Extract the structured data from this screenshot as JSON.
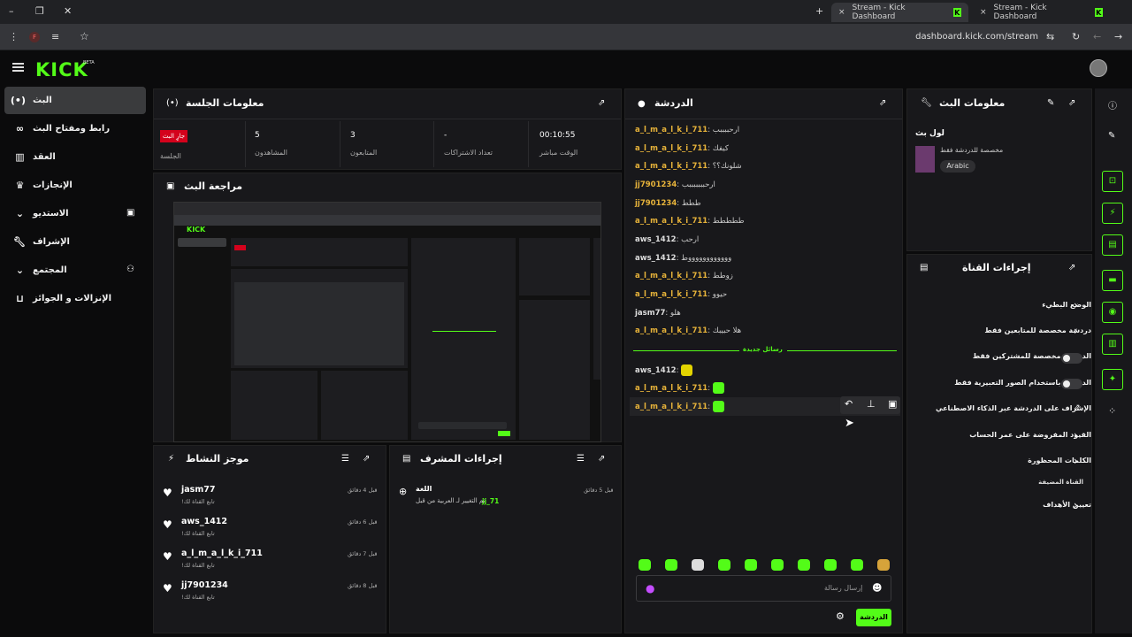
{
  "browser": {
    "tabs": [
      {
        "title": "Stream - Kick Dashboard"
      },
      {
        "title": "Stream - Kick Dashboard"
      }
    ],
    "url": "dashboard.kick.com/stream",
    "plus": "+",
    "close": "×"
  },
  "header": {
    "logo": "KICK",
    "beta": "BETA"
  },
  "sidebar": {
    "items": [
      {
        "label": "البث"
      },
      {
        "label": "رابط ومفتاح البث"
      },
      {
        "label": "العقد"
      },
      {
        "label": "الإنجازات"
      },
      {
        "label": "الاستديو"
      },
      {
        "label": "الإشراف"
      },
      {
        "label": "المجتمع"
      },
      {
        "label": "الإنزالات و الجوائز"
      }
    ]
  },
  "session": {
    "title": "معلومات الجلسة",
    "live_badge": "جارٍ البث",
    "stats": [
      {
        "value": "",
        "label": "الجلسة"
      },
      {
        "value": "5",
        "label": "المشاهدون"
      },
      {
        "value": "3",
        "label": "المتابعون"
      },
      {
        "value": "-",
        "label": "تعداد الاشتراكات"
      },
      {
        "value": "00:10:55",
        "label": "الوقت مباشر"
      }
    ]
  },
  "preview": {
    "title": "مراجعة البث"
  },
  "activity": {
    "title": "موجز النشاط",
    "items": [
      {
        "name": "jasm77",
        "sub": "تابع القناة لك!",
        "time": "قبل 4 دقائق"
      },
      {
        "name": "aws_1412",
        "sub": "تابع القناة لك!",
        "time": "قبل 6 دقائق"
      },
      {
        "name": "a_l_m_a_l_k_i_711",
        "sub": "تابع القناة لك!",
        "time": "قبل 7 دقائق"
      },
      {
        "name": "jj7901234",
        "sub": "تابع القناة لك!",
        "time": "قبل 8 دقائق"
      }
    ]
  },
  "modactions": {
    "title": "إجراءات المشرف",
    "items": [
      {
        "title": "اللغة",
        "user": "jj_71",
        "text": "تم التغيير لـ العربية من قبل",
        "time": "قبل 5 دقائق"
      }
    ]
  },
  "chat": {
    "title": "الدردشة",
    "messages": [
      {
        "user": "a_l_m_a_l_k_i_711",
        "text": "ارحببببب"
      },
      {
        "user": "a_l_m_a_l_k_i_711",
        "text": "كيفك"
      },
      {
        "user": "a_l_m_a_l_k_i_711",
        "text": "شلونك؟؟"
      },
      {
        "user": "jj7901234",
        "text": "ارحبببببببب"
      },
      {
        "user": "jj7901234",
        "text": "ططط"
      },
      {
        "user": "a_l_m_a_l_k_i_711",
        "text": "ططططط"
      },
      {
        "user": "aws_1412",
        "text": "ارحب"
      },
      {
        "user": "aws_1412",
        "text": "ووووووووووووط"
      },
      {
        "user": "a_l_m_a_l_k_i_711",
        "text": "زوطط"
      },
      {
        "user": "a_l_m_a_l_k_i_711",
        "text": "حيوو"
      },
      {
        "user": "jasm77",
        "text": "هلو"
      },
      {
        "user": "a_l_m_a_l_k_i_711",
        "text": "هلا حبيبك"
      }
    ],
    "new_messages": "رسائل جديدة",
    "emote_messages": [
      {
        "user": "aws_1412"
      },
      {
        "user": "a_l_m_a_l_k_i_711"
      },
      {
        "user": "a_l_m_a_l_k_i_711"
      }
    ],
    "input_placeholder": "إرسال رسالة",
    "send_label": "الدردشة"
  },
  "streaminfo": {
    "title": "معلومات البث",
    "stream_title": "لول بث",
    "category": "مخصصة للدردشة فقط",
    "language": "Arabic"
  },
  "channel_actions": {
    "title": "إجراءات القناة",
    "items": [
      {
        "label": "الوضع البطيء",
        "control": "chevron"
      },
      {
        "label": "دردشة مخصصة للمتابعين فقط",
        "control": "chevron"
      },
      {
        "label": "الدردشة مخصصة للمشتركين فقط",
        "control": "toggle"
      },
      {
        "label": "الدردشة باستخدام الصور التعبيرية فقط",
        "control": "toggle"
      },
      {
        "label": "الإشراف على الدردشة عبر الذكاء الاصطناعي",
        "control": "external"
      },
      {
        "label": "القيود المفروضة على عمر الحساب",
        "control": "chevron"
      },
      {
        "label": "الكلمات المحظورة",
        "control": "chevron"
      }
    ],
    "section": "القناة المضيفة",
    "goals": "تعيين الأهداف"
  }
}
